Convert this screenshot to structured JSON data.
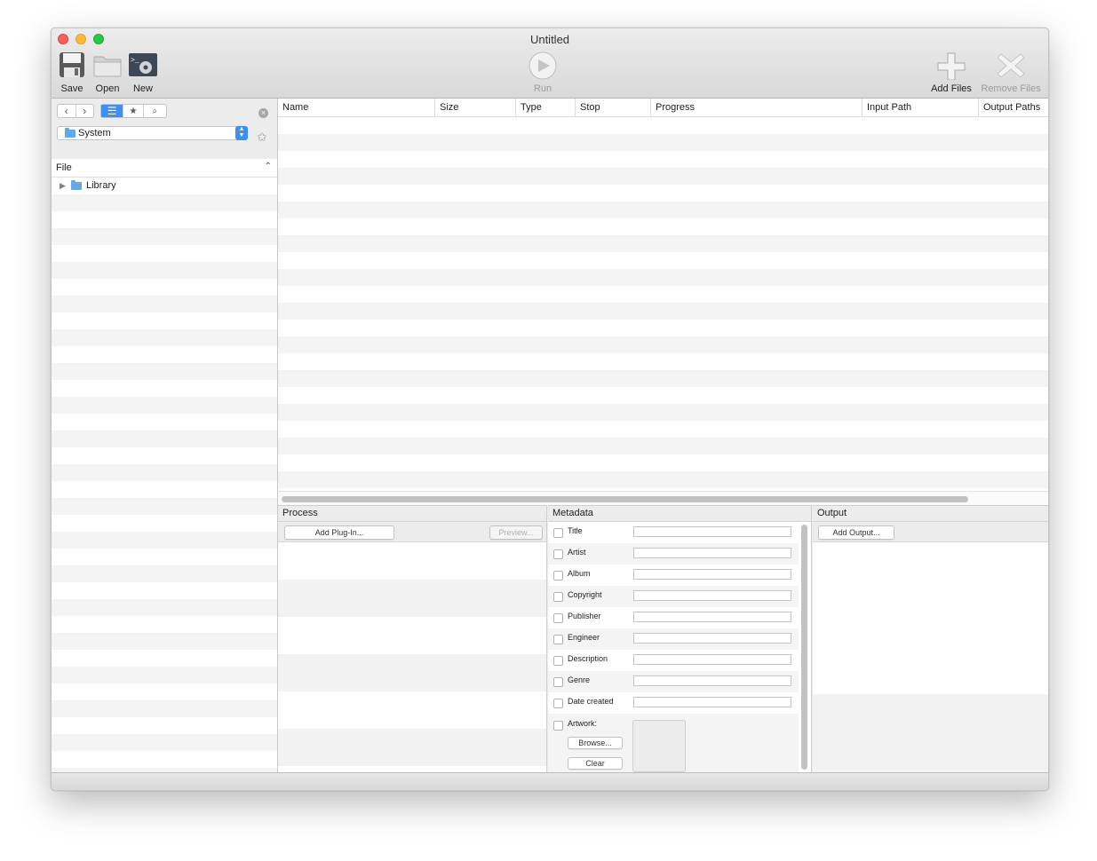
{
  "window": {
    "title": "Untitled"
  },
  "toolbar": {
    "save_label": "Save",
    "open_label": "Open",
    "new_label": "New",
    "run_label": "Run",
    "add_files_label": "Add Files",
    "remove_files_label": "Remove Files"
  },
  "browser": {
    "location": "System",
    "column_header": "File",
    "items": [
      {
        "label": "Library"
      }
    ]
  },
  "file_table": {
    "columns": [
      "Name",
      "Size",
      "Type",
      "Stop",
      "Progress",
      "Input Path",
      "Output Paths"
    ]
  },
  "process": {
    "title": "Process",
    "add_plugin_label": "Add Plug-In...",
    "preview_label": "Preview..."
  },
  "metadata": {
    "title": "Metadata",
    "fields": [
      "Title",
      "Artist",
      "Album",
      "Copyright",
      "Publisher",
      "Engineer",
      "Description",
      "Genre",
      "Date created"
    ],
    "artwork_label": "Artwork:",
    "browse_label": "Browse...",
    "clear_label": "Clear"
  },
  "output": {
    "title": "Output",
    "add_output_label": "Add Output..."
  },
  "colors": {
    "accent": "#3d8ef5",
    "close": "#fc5f57",
    "minimize": "#fdbc2e",
    "zoom": "#28c840"
  }
}
